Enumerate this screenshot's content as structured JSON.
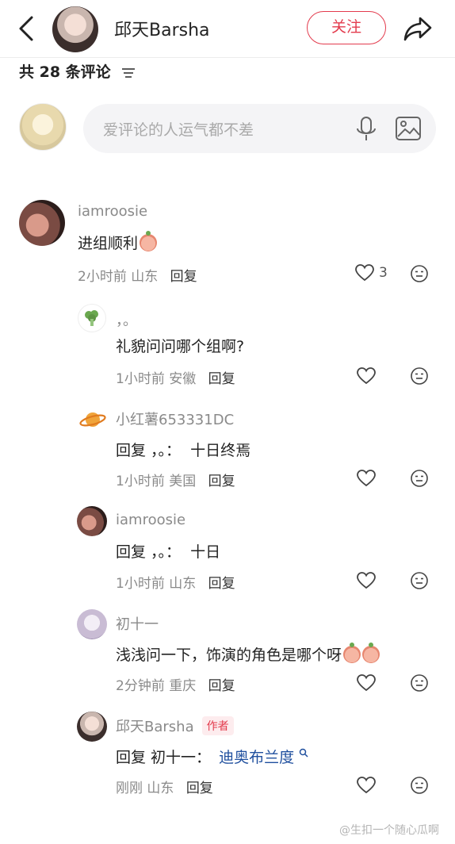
{
  "header": {
    "name": "邱天Barsha",
    "follow_label": "关注"
  },
  "comments_count_label": "共 28 条评论",
  "input": {
    "placeholder": "爱评论的人运气都不差"
  },
  "comments": [
    {
      "user": "iamroosie",
      "text": "进组顺利",
      "time": "2小时前",
      "location": "山东",
      "reply": "回复",
      "likes": "3"
    },
    {
      "user": "，。",
      "text": "礼貌问问哪个组啊?",
      "time": "1小时前",
      "location": "安徽",
      "reply": "回复"
    },
    {
      "user": "小红薯653331DC",
      "text_prefix": "回复 ，。：",
      "text": "十日终焉",
      "time": "1小时前",
      "location": "美国",
      "reply": "回复"
    },
    {
      "user": "iamroosie",
      "text_prefix": "回复 ，。：",
      "text": "十日",
      "time": "1小时前",
      "location": "山东",
      "reply": "回复"
    },
    {
      "user": "初十一",
      "text": "浅浅问一下，饰演的角色是哪个呀",
      "time": "2分钟前",
      "location": "重庆",
      "reply": "回复"
    },
    {
      "user": "邱天Barsha",
      "badge": "作者",
      "text_prefix": "回复 初十一：",
      "text": "迪奥布兰度",
      "time": "刚刚",
      "location": "山东",
      "reply": "回复"
    }
  ],
  "watermark": "@生扣一个随心瓜啊",
  "colors": {
    "accent": "#e33b4d",
    "link": "#1f4f9e"
  }
}
